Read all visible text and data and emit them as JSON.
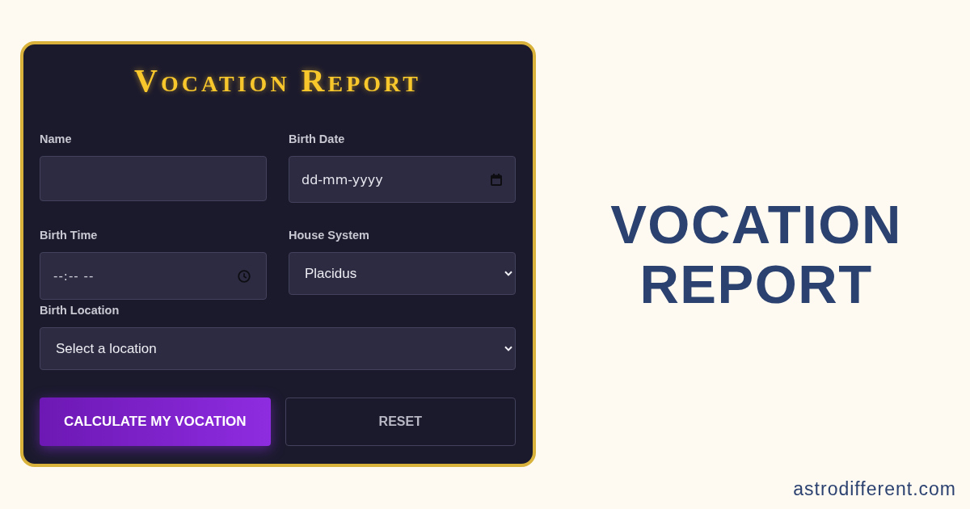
{
  "card": {
    "title": "Vocation Report",
    "rows": [
      [
        {
          "label": "Name",
          "kind": "text"
        },
        {
          "label": "Birth Date",
          "kind": "date",
          "placeholder": "dd-mm-yyyy"
        }
      ],
      [
        {
          "label": "Birth Time",
          "kind": "time",
          "placeholder": "--:-- --"
        },
        {
          "label": "House System",
          "kind": "select",
          "value": "Placidus"
        }
      ],
      [
        {
          "label": "Birth Location",
          "kind": "select",
          "placeholder": "Select a location"
        }
      ]
    ],
    "buttons": [
      {
        "label": "CALCULATE MY VOCATION",
        "kind": "submit"
      },
      {
        "label": "RESET",
        "kind": "reset"
      }
    ]
  },
  "headline": "VOCATION REPORT",
  "site": "astrodifferent.com"
}
